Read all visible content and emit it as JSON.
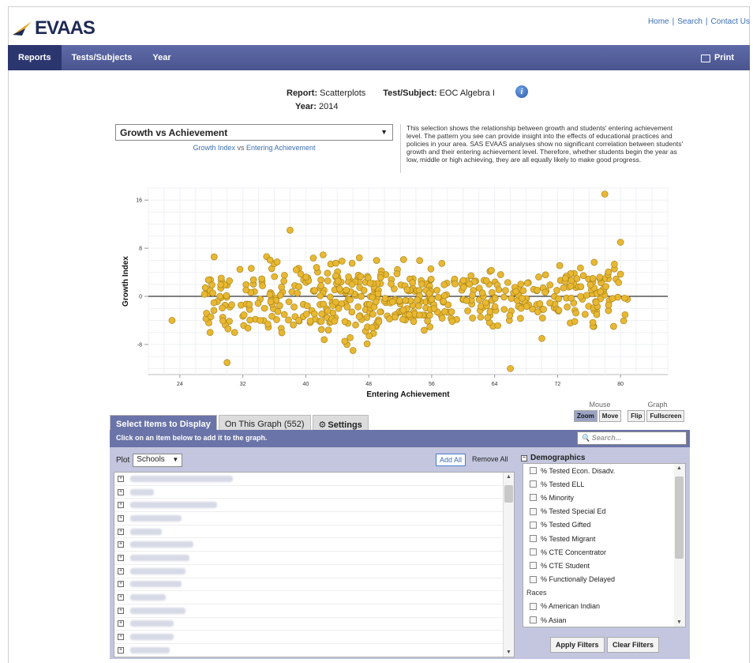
{
  "app": {
    "logo_text": "EVAAS"
  },
  "top_links": [
    "Home",
    "Search",
    "Contact Us"
  ],
  "nav": {
    "items": [
      "Reports",
      "Tests/Subjects",
      "Year"
    ],
    "print_label": "Print"
  },
  "report": {
    "report_label": "Report:",
    "report_value": "Scatterplots",
    "test_label": "Test/Subject:",
    "test_value": "EOC Algebra I",
    "year_label": "Year:",
    "year_value": "2014"
  },
  "graph_select": {
    "value": "Growth vs Achievement",
    "sub_a": "Growth Index",
    "sub_vs": "vs",
    "sub_b": "Entering Achievement"
  },
  "description": "This selection shows the relationship between growth and students' entering achievement level. The pattern you see can provide insight into the effects of educational practices and policies in your area. SAS EVAAS analyses show no significant correlation between students' growth and their entering achievement level. Therefore, whether students begin the year as low, middle or high achieving, they are all equally likely to make good progress.",
  "chart_data": {
    "type": "scatter",
    "xlabel": "Entering Achievement",
    "ylabel": "Growth Index",
    "xlim": [
      20,
      86
    ],
    "ylim": [
      -13,
      18
    ],
    "x_ticks": [
      24,
      32,
      40,
      48,
      56,
      64,
      72,
      80
    ],
    "y_ticks": [
      16,
      8,
      0,
      -8
    ],
    "point_color": "#e8b832",
    "point_count": 552,
    "clusters": [
      {
        "x": [
          27,
          32
        ],
        "y": [
          -6,
          9
        ],
        "n": 40
      },
      {
        "x": [
          32,
          40
        ],
        "y": [
          -7,
          9
        ],
        "n": 70
      },
      {
        "x": [
          40,
          48
        ],
        "y": [
          -8,
          10
        ],
        "n": 110
      },
      {
        "x": [
          48,
          56
        ],
        "y": [
          -8,
          8
        ],
        "n": 120
      },
      {
        "x": [
          56,
          64
        ],
        "y": [
          -7,
          6
        ],
        "n": 70
      },
      {
        "x": [
          64,
          72
        ],
        "y": [
          -6,
          6
        ],
        "n": 60
      },
      {
        "x": [
          72,
          81
        ],
        "y": [
          -5,
          9
        ],
        "n": 82
      }
    ],
    "outliers": [
      [
        23,
        -4
      ],
      [
        78,
        17
      ],
      [
        66,
        -12
      ],
      [
        30,
        -11
      ],
      [
        46,
        -9
      ],
      [
        70,
        -7
      ],
      [
        80,
        9
      ],
      [
        38,
        11
      ]
    ]
  },
  "graph_controls": {
    "mouse_label": "Mouse",
    "graph_label": "Graph",
    "buttons": [
      "Zoom",
      "Move",
      "Flip",
      "Fullscreen"
    ]
  },
  "tabs": [
    "Select Items to Display",
    "On This Graph (552)",
    "Settings"
  ],
  "panel": {
    "instruction": "Click on an item below to add it to the graph.",
    "search_placeholder": "Search...",
    "plot_label": "Plot",
    "plot_value": "Schools",
    "add_all": "Add All",
    "remove_all": "Remove All"
  },
  "demographics": {
    "title": "Demographics",
    "items": [
      "% Tested Econ. Disadv.",
      "% Tested ELL",
      "% Minority",
      "% Tested Special Ed",
      "% Tested Gifted",
      "% Tested Migrant",
      "% CTE Concentrator",
      "% CTE Student",
      "% Functionally Delayed"
    ],
    "races_label": "Races",
    "race_items": [
      "% American Indian",
      "% Asian"
    ]
  },
  "filter_buttons": {
    "apply": "Apply Filters",
    "clear": "Clear Filters"
  }
}
